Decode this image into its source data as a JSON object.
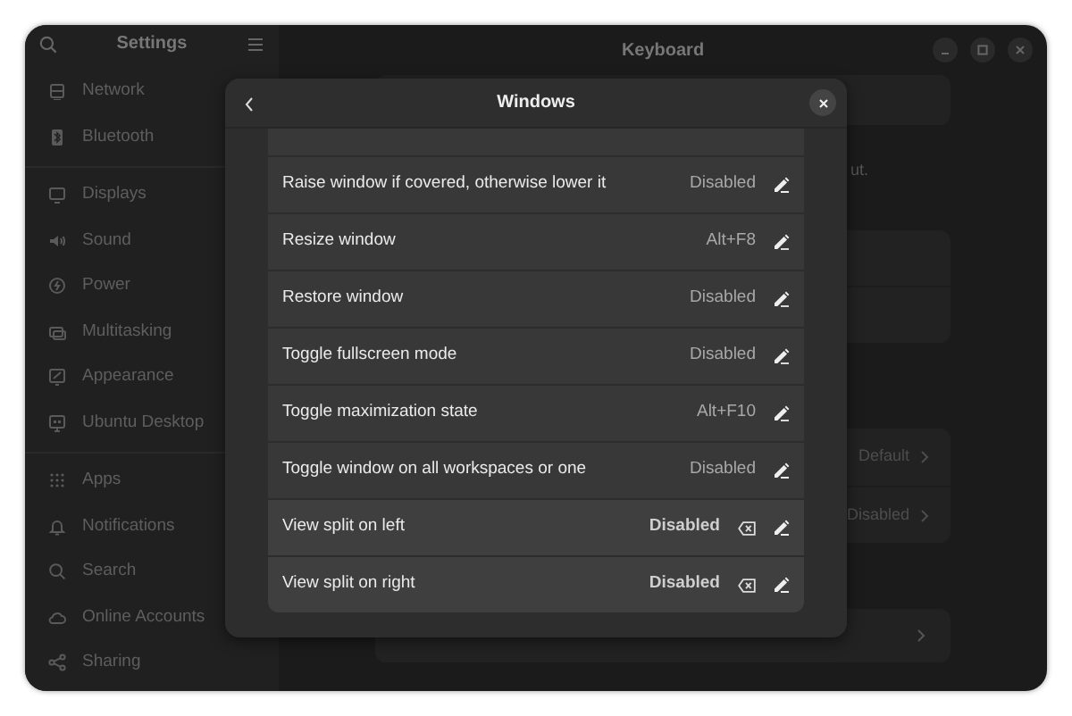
{
  "window": {
    "title": "Keyboard",
    "sidebar_title": "Settings"
  },
  "sidebar": {
    "groups": [
      [
        {
          "label": "Network"
        },
        {
          "label": "Bluetooth"
        }
      ],
      [
        {
          "label": "Displays"
        },
        {
          "label": "Sound"
        },
        {
          "label": "Power"
        },
        {
          "label": "Multitasking"
        },
        {
          "label": "Appearance"
        },
        {
          "label": "Ubuntu Desktop"
        }
      ],
      [
        {
          "label": "Apps"
        },
        {
          "label": "Notifications"
        },
        {
          "label": "Search"
        },
        {
          "label": "Online Accounts"
        },
        {
          "label": "Sharing"
        }
      ]
    ]
  },
  "background": {
    "cut_text": "ut.",
    "options": [
      {
        "value": "Default"
      },
      {
        "value": "Disabled"
      }
    ]
  },
  "dialog": {
    "title": "Windows",
    "rows": [
      {
        "label": "Raise window if covered, otherwise lower it",
        "shortcut": "Disabled",
        "modified": false
      },
      {
        "label": "Resize window",
        "shortcut": "Alt+F8",
        "modified": false
      },
      {
        "label": "Restore window",
        "shortcut": "Disabled",
        "modified": false
      },
      {
        "label": "Toggle fullscreen mode",
        "shortcut": "Disabled",
        "modified": false
      },
      {
        "label": "Toggle maximization state",
        "shortcut": "Alt+F10",
        "modified": false
      },
      {
        "label": "Toggle window on all workspaces or one",
        "shortcut": "Disabled",
        "modified": false
      },
      {
        "label": "View split on left",
        "shortcut": "Disabled",
        "modified": true
      },
      {
        "label": "View split on right",
        "shortcut": "Disabled",
        "modified": true
      }
    ]
  }
}
